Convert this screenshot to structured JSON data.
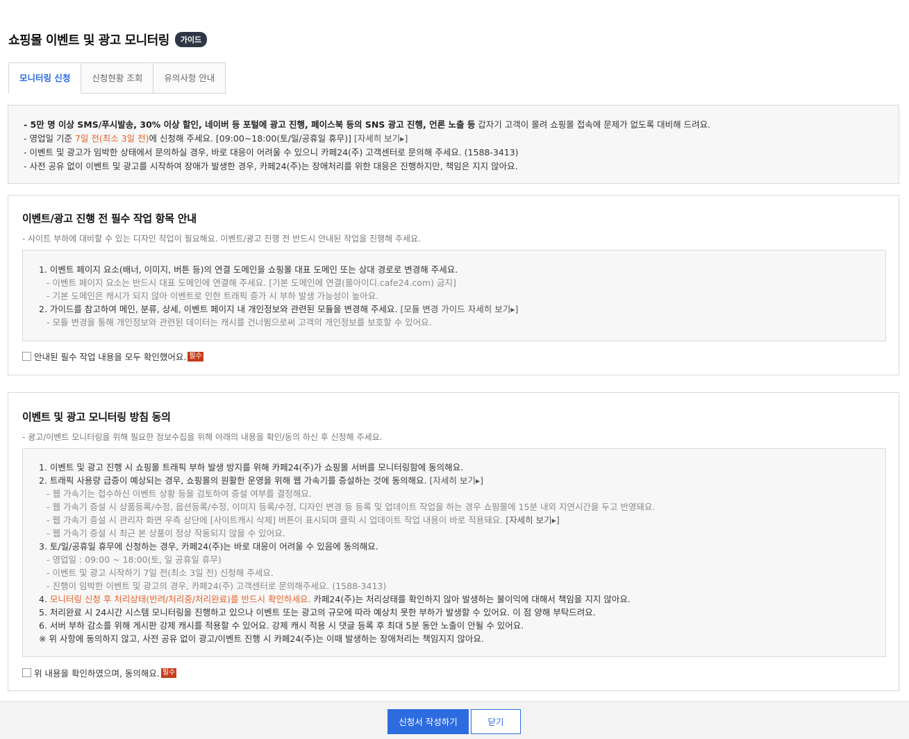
{
  "header": {
    "title": "쇼핑몰 이벤트 및 광고 모니터링",
    "guide_badge": "가이드"
  },
  "tabs": [
    {
      "label": "모니터링 신청",
      "active": true
    },
    {
      "label": "신청현황 조회",
      "active": false
    },
    {
      "label": "유의사항 안내",
      "active": false
    }
  ],
  "notice": {
    "line1_bold": "- 5만 명 이상 SMS/푸시발송, 30% 이상 할인, 네이버 등 포털에 광고 진행, 페이스북 등의 SNS 광고 진행, 언론 노출 등",
    "line1_rest": " 갑자기 고객이 몰려 쇼핑몰 접속에 문제가 없도록 대비해 드려요.",
    "line2_a": "- 영업일 기준 ",
    "line2_highlight": "7일 전(최소 3일 전)",
    "line2_b": "에 신청해 주세요. [09:00~18:00(토/일/공휴일 휴무)] ",
    "line2_link": "[자세히 보기▸]",
    "line3": "- 이벤트 및 광고가 임박한 상태에서 문의하실 경우, 바로 대응이 어려울 수 있으니 카페24(주) 고객센터로 문의해 주세요. (1588-3413)",
    "line4": "- 사전 공유 없이 이벤트 및 광고를 시작하여 장애가 발생한 경우, 카페24(주)는 장애처리를 위한 대응은 진행하지만, 책임은 지지 않아요."
  },
  "required_tasks": {
    "title": "이벤트/광고 진행 전 필수 작업 항목 안내",
    "desc": "- 사이트 부하에 대비할 수 있는 디자인 작업이 필요해요. 이벤트/광고 진행 전 반드시 안내된 작업을 진행해 주세요.",
    "item1": "1. 이벤트 페이지 요소(배너, 이미지, 버튼 등)의 연결 도메인을 쇼핑몰 대표 도메인 또는 상대 경로로 변경해 주세요.",
    "item1_sub1": "- 이벤트 페이지 요소는 반드시 대표 도메인에 연결해 주세요. [기본 도메인에 연결(몰아이디.cafe24.com) 금지]",
    "item1_sub2": "- 기본 도메인은 캐시가 되지 않아 이벤트로 인한 트래픽 증가 시 부하 발생 가능성이 높아요.",
    "item2": "2. 가이드를 참고하여 메인, 분류, 상세, 이벤트 페이지 내 개인정보와 관련된 모듈을 변경해 주세요. ",
    "item2_link": "[모듈 변경 가이드 자세히 보기▸]",
    "item2_sub1": "- 모듈 변경을 통해 개인정보와 관련된 데이터는 캐시를 건너뜀으로써 고객의 개인정보를 보호할 수 있어요.",
    "checkbox_label": "안내된 필수 작업 내용을 모두 확인했어요.",
    "required_badge": "필수"
  },
  "policy": {
    "title": "이벤트 및 광고 모니터링 방침 동의",
    "desc": "- 광고/이벤트 모니터링을 위해 필요한 정보수집을 위해 아래의 내용을 확인/동의 하신 후 신청해 주세요.",
    "item1": "1. 이벤트 및 광고 진행 시 쇼핑몰 트래픽 부하 발생 방지를 위해 카페24(주)가 쇼핑몰 서버를 모니터링함에 동의해요.",
    "item2": "2. 트래픽 사용량 급증이 예상되는 경우, 쇼핑몰의 원활한 운영을 위해 웹 가속기를 증설하는 것에 동의해요. ",
    "item2_link": "[자세히 보기▸]",
    "item2_sub1": "- 웹 가속기는 접수하신 이벤트 상황 등을 검토하여 증설 여부를 결정해요.",
    "item2_sub2": "- 웹 가속기 증설 시 상품등록/수정, 옵션등록/수정, 이미지 등록/수정, 디자인 변경 등 등록 및 업데이트 작업을 하는 경우 쇼핑몰에 15분 내외 지연시간을 두고 반영돼요.",
    "item2_sub3": "- 웹 가속기 증설 시 관리자 화면 우측 상단에 [사이트캐시 삭제] 버튼이 표시되며 클릭 시 업데이트 작업 내용이 바로 적용돼요. ",
    "item2_sub3_link": "[자세히 보기▸]",
    "item2_sub4": "- 웹 가속기 증설 시 최근 본 상품이 정상 작동되지 않을 수 있어요.",
    "item3": "3. 토/일/공휴일 휴무에 신청하는 경우, 카페24(주)는 바로 대응이 어려울 수 있음에 동의해요.",
    "item3_sub1": "- 영업일 : 09:00 ~ 18:00(토, 일 공휴일 휴무)",
    "item3_sub2": "- 이벤트 및 광고 시작하기 7일 전(최소 3일 전) 신청해 주세요.",
    "item3_sub3": "- 진행이 임박한 이벤트 및 광고의 경우, 카페24(주) 고객센터로 문의해주세요. (1588-3413)",
    "item4_num": "4. ",
    "item4_highlight": "모니터링 신청 후 처리상태(반려/처리중/처리완료)를 반드시 확인하세요.",
    "item4_rest": " 카페24(주)는 처리상태를 확인하지 않아 발생하는 불이익에 대해서 책임을 지지 않아요.",
    "item5": "5. 처리완료 시 24시간 시스템 모니터링을 진행하고 있으나 이벤트 또는 광고의 규모에 따라 예상치 못한 부하가 발생할 수 있어요. 이 점 양해 부탁드려요.",
    "item6": "6. 서버 부하 감소를 위해 게시판 강제 캐시를 적용할 수 있어요. 강제 캐시 적용 시 댓글 등록 후 최대 5분 동안 노출이 안될 수 있어요.",
    "note": "※ 위 사항에 동의하지 않고, 사전 공유 없이 광고/이벤트 진행 시 카페24(주)는 이때 발생하는 장애처리는 책임지지 않아요.",
    "checkbox_label": "위 내용을 확인하였으며, 동의해요.",
    "required_badge": "필수"
  },
  "footer": {
    "submit_label": "신청서 작성하기",
    "close_label": "닫기"
  },
  "colors": {
    "accent": "#2d6cdf",
    "highlight": "#e6622a",
    "required": "#c43d1a",
    "badge": "#2f3745"
  }
}
